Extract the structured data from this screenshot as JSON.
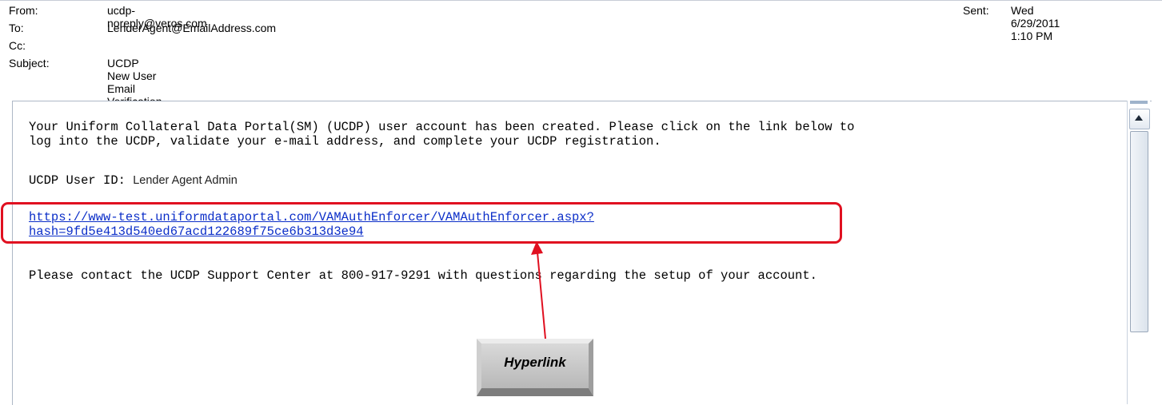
{
  "email": {
    "from_label": "From:",
    "from_value": "ucdp-noreply@veros.com",
    "to_label": "To:",
    "to_value": "LenderAgent@EmailAddress.com",
    "cc_label": "Cc:",
    "cc_value": "",
    "subject_label": "Subject:",
    "subject_value": "UCDP New User Email Verification Required",
    "sent_label": "Sent:",
    "sent_value": "Wed 6/29/2011 1:10 PM"
  },
  "body": {
    "paragraph1": "Your Uniform Collateral Data Portal(SM) (UCDP) user account has been created. Please click on the link below to\nlog into the UCDP, validate your e-mail address, and complete your UCDP registration.",
    "user_id_label": "UCDP User ID:",
    "user_id_value": "Lender Agent Admin",
    "link": "https://www-test.uniformdataportal.com/VAMAuthEnforcer/VAMAuthEnforcer.aspx?\nhash=9fd5e413d540ed67acd122689f75ce6b313d3e94",
    "paragraph3": "Please contact the UCDP Support Center at 800-917-9291 with questions regarding the setup of your account."
  },
  "annotation": {
    "callout_label": "Hyperlink",
    "highlight_color": "#e01020"
  },
  "icons": {
    "scroll_up": "scroll-up-arrow-icon"
  }
}
